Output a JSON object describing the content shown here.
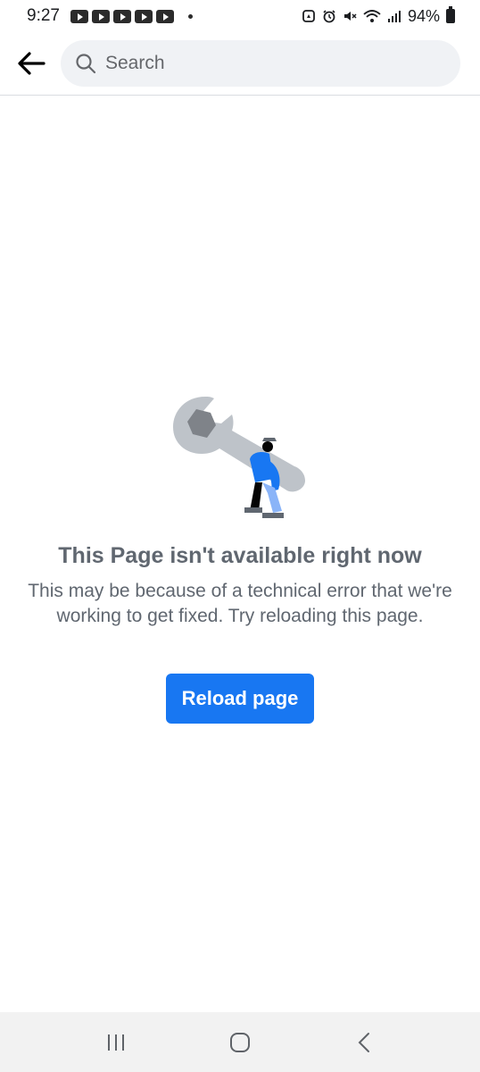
{
  "status_bar": {
    "time": "9:27",
    "notification_icons": [
      "youtube-icon",
      "youtube-icon",
      "youtube-icon",
      "youtube-icon",
      "youtube-icon"
    ],
    "system_icons": [
      "recycle-icon",
      "alarm-icon",
      "mute-icon",
      "wifi-icon",
      "signal-icon"
    ],
    "battery": "94%"
  },
  "top_bar": {
    "back_icon": "arrow-left-icon",
    "search": {
      "placeholder": "Search",
      "value": ""
    }
  },
  "error": {
    "illustration": "wrench-worker-illustration",
    "title": "This Page isn't available right now",
    "body": "This may be because of a technical error that we're working to get fixed. Try reloading this page.",
    "reload_label": "Reload page"
  },
  "nav_bar": {
    "buttons": [
      "recent-apps-icon",
      "home-icon",
      "back-icon"
    ]
  },
  "colors": {
    "accent": "#1877f2",
    "text_muted": "#606770",
    "search_bg": "#f0f2f5"
  }
}
